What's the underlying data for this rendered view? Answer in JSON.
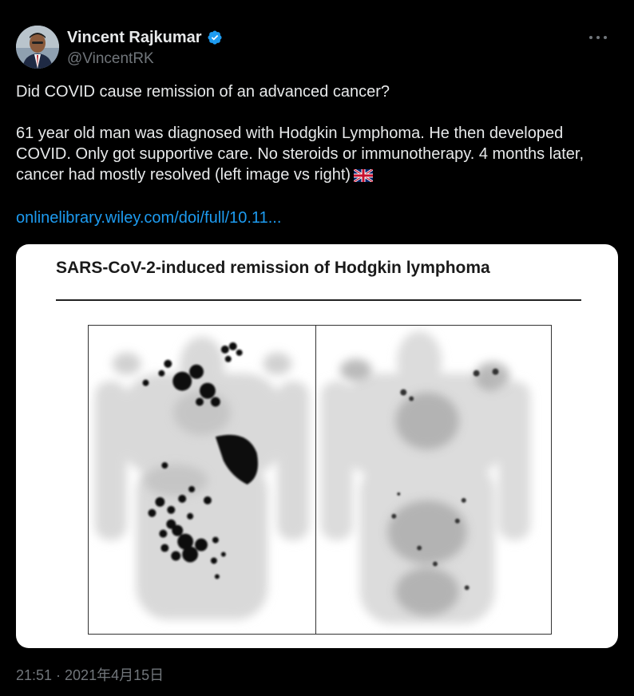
{
  "author": {
    "display_name": "Vincent Rajkumar",
    "handle": "@VincentRK"
  },
  "tweet": {
    "line1": "Did COVID cause remission of an advanced cancer?",
    "line2": "61 year old man was diagnosed with Hodgkin Lymphoma. He then developed",
    "line3": "COVID. Only got supportive care. No steroids or immunotherapy. 4 months later,",
    "line4": "cancer had mostly resolved (left image vs right)",
    "link": "onlinelibrary.wiley.com/doi/full/10.11..."
  },
  "media": {
    "figure_title": "SARS-CoV-2-induced remission of Hodgkin lymphoma"
  },
  "timestamp": "21:51 · 2021年4月15日",
  "icons": [
    "verified-badge-icon",
    "more-options-icon",
    "uk-flag-emoji-icon"
  ],
  "colors": {
    "background": "#000000",
    "text": "#e7e9ea",
    "secondary": "#71767b",
    "link": "#1d9bf0",
    "verified": "#1d9bf0"
  }
}
